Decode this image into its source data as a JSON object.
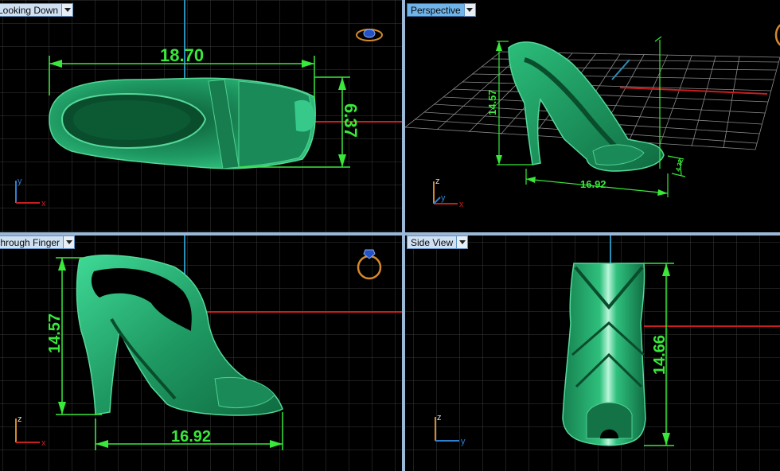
{
  "viewports": [
    {
      "id": "top",
      "title": "Looking Down",
      "active": false,
      "dimensions": [
        "18.70",
        "6.37"
      ],
      "axes": [
        "y",
        "x"
      ]
    },
    {
      "id": "perspective",
      "title": "Perspective",
      "active": true,
      "dimensions": [
        "14.57",
        "16.92",
        "4.32"
      ],
      "axes": [
        "z",
        "y",
        "x"
      ]
    },
    {
      "id": "front",
      "title": "Through Finger",
      "active": false,
      "dimensions": [
        "14.57",
        "16.92"
      ],
      "axes": [
        "z",
        "x"
      ]
    },
    {
      "id": "side",
      "title": "Side View",
      "active": false,
      "dimensions": [
        "14.66"
      ],
      "axes": [
        "z",
        "y"
      ]
    }
  ],
  "colors": {
    "background": "#000000",
    "grid": "#3a3a3a",
    "dimension": "#39e83a",
    "model": "#1f9a63",
    "x_axis": "#c81e1e",
    "y_axis_line": "#2a8fb8",
    "axis_icon_y": "#2f7fd0",
    "active_tab": "#6fb3e8"
  },
  "icons": [
    "ring-view-icon",
    "axis-triad-icon",
    "viewport-menu-icon"
  ]
}
